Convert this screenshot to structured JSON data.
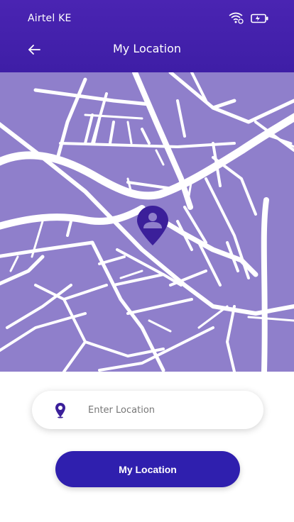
{
  "status": {
    "carrier": "Airtel KE",
    "wifi_icon": "wifi-icon",
    "battery_icon": "battery-charging-icon"
  },
  "header": {
    "title": "My Location",
    "back_icon": "arrow-left-icon"
  },
  "map": {
    "bg": "#8f7fcb",
    "road": "#ffffff",
    "pin_color": "#3b1f9a",
    "pin_icon": "user-location-pin-icon"
  },
  "search": {
    "placeholder": "Enter Location",
    "value": "",
    "icon": "map-pin-icon"
  },
  "button": {
    "label": "My Location"
  },
  "colors": {
    "header": "#4321ad",
    "primary": "#2f1fae"
  }
}
